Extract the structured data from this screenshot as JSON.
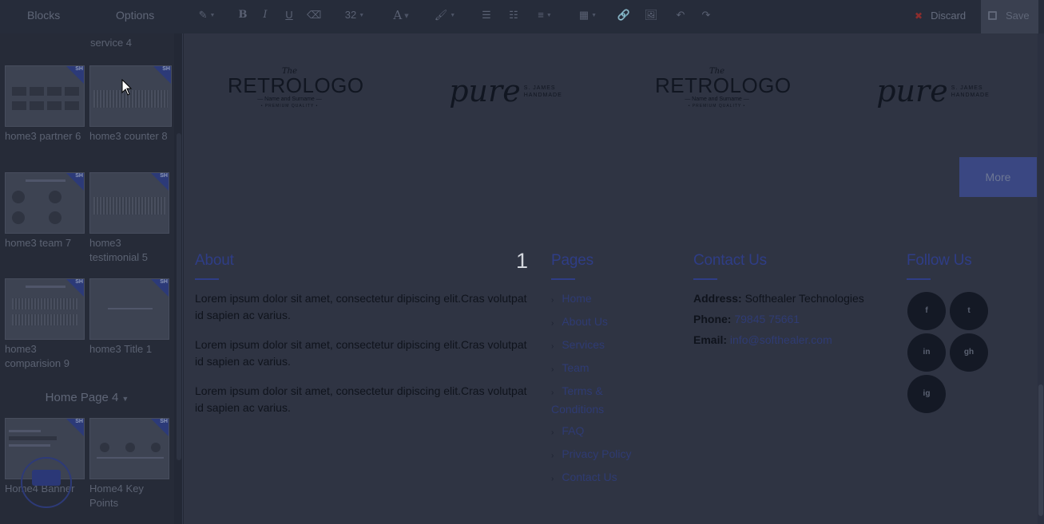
{
  "toolbar": {
    "tabs": [
      "Blocks",
      "Options"
    ],
    "font_size": "32",
    "discard_label": "Discard",
    "save_label": "Save",
    "icons": [
      "pen-icon",
      "bold-icon",
      "italic-icon",
      "underline-icon",
      "eraser-icon",
      "font-size-select",
      "text-color-icon",
      "highlight-icon",
      "unordered-list-icon",
      "ordered-list-icon",
      "align-icon",
      "table-icon",
      "link-icon",
      "image-icon",
      "undo-icon",
      "redo-icon"
    ]
  },
  "sidebar": {
    "cut_item_name": "service 4",
    "blocks": [
      {
        "name": "home3 partner 6",
        "style": "grid"
      },
      {
        "name": "home3 counter 8",
        "style": "texture"
      },
      {
        "name": "home3 team 7",
        "style": "team"
      },
      {
        "name": "home3 testimonial 5",
        "style": "texture"
      },
      {
        "name": "home3 comparision 9",
        "style": "compare"
      },
      {
        "name": "home3 Title 1",
        "style": "title"
      }
    ],
    "category": "Home Page 4",
    "category_blocks": [
      {
        "name": "Home4 Banner",
        "style": "banner"
      },
      {
        "name": "Home4 Key Points",
        "style": "keypoints"
      }
    ],
    "badge_text": "SH"
  },
  "canvas": {
    "logos": [
      {
        "type": "retro",
        "the": "The",
        "word": "RETROLOGO",
        "sub": "— Name and Surname —",
        "sub2": "• PREMIUM QUALITY •"
      },
      {
        "type": "pure",
        "script": "pure",
        "side1": "S. JAMES",
        "side2": "HANDMADE"
      },
      {
        "type": "retro",
        "the": "The",
        "word": "RETROLOGO",
        "sub": "— Name and Surname —",
        "sub2": "• PREMIUM QUALITY •"
      },
      {
        "type": "pure",
        "script": "pure",
        "side1": "S. JAMES",
        "side2": "HANDMADE"
      }
    ],
    "more_label": "More",
    "overlay_number": "1",
    "about": {
      "title": "About",
      "paragraphs": [
        "Lorem ipsum dolor sit amet, consectetur dipiscing elit.Cras volutpat id sapien ac varius.",
        "Lorem ipsum dolor sit amet, consectetur dipiscing elit.Cras volutpat id sapien ac varius.",
        "Lorem ipsum dolor sit amet, consectetur dipiscing elit.Cras volutpat id sapien ac varius."
      ]
    },
    "pages": {
      "title": "Pages",
      "items": [
        "Home",
        "About Us",
        "Services",
        "Team",
        "Terms & Conditions",
        "FAQ",
        "Privacy Policy",
        "Contact Us"
      ]
    },
    "contact": {
      "title": "Contact Us",
      "address_label": "Address:",
      "address": "Softhealer Technologies",
      "phone_label": "Phone:",
      "phone": "79845 75661",
      "email_label": "Email:",
      "email": "info@softhealer.com"
    },
    "follow": {
      "title": "Follow Us",
      "icons": [
        {
          "name": "facebook-icon",
          "glyph": "f"
        },
        {
          "name": "twitter-icon",
          "glyph": "t"
        },
        {
          "name": "linkedin-icon",
          "glyph": "in"
        },
        {
          "name": "github-icon",
          "glyph": "gh"
        },
        {
          "name": "instagram-icon",
          "glyph": "ig"
        }
      ]
    }
  }
}
